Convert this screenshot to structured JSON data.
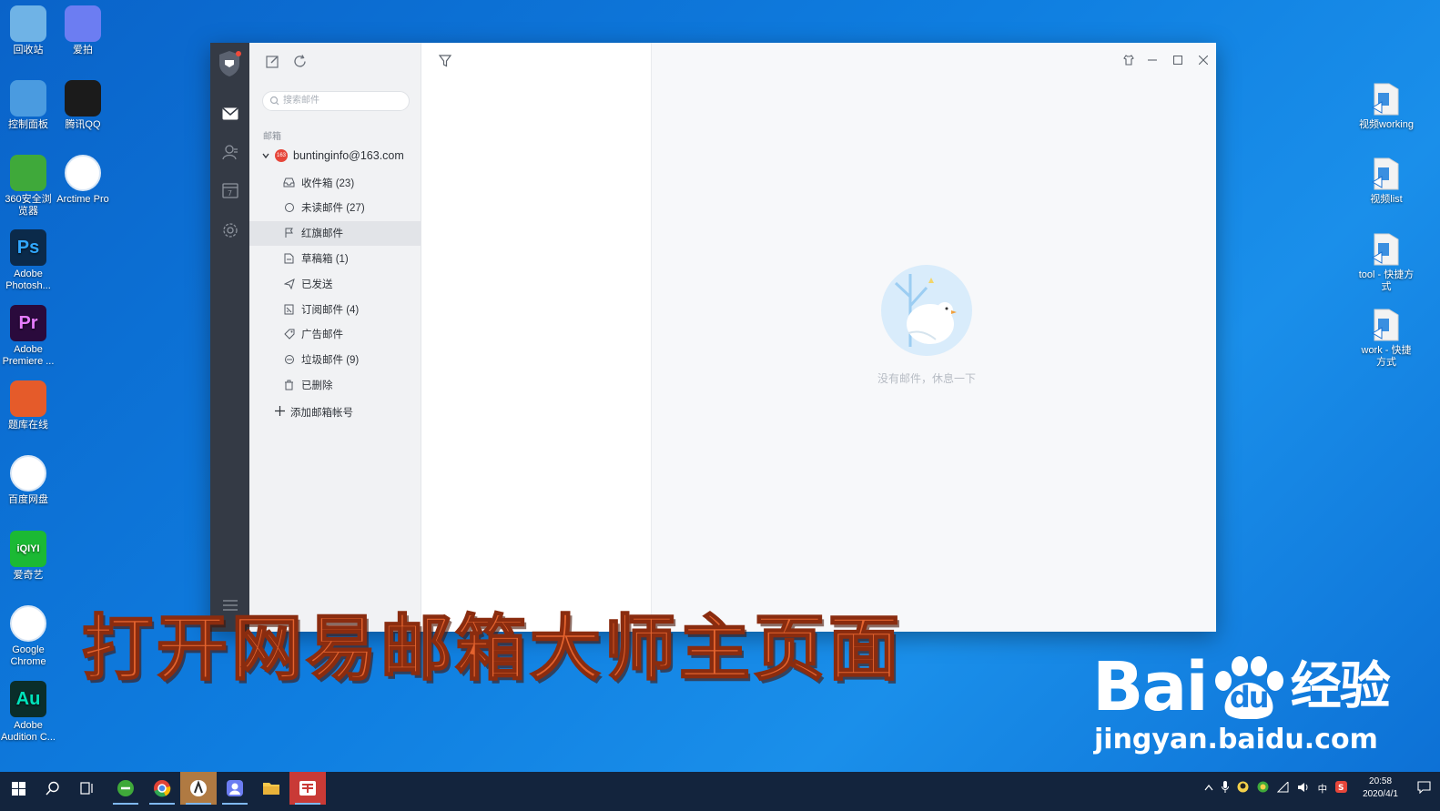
{
  "desktop": {
    "left_icons": [
      {
        "label": "回收站",
        "icon": "recycle-bin-icon",
        "color": "#6fb3e6"
      },
      {
        "label": "爱拍",
        "icon": "aipai-icon",
        "color": "#6c7df2"
      },
      {
        "label": "控制面板",
        "icon": "control-panel-icon",
        "color": "#4a9be0"
      },
      {
        "label": "腾讯QQ",
        "icon": "qq-penguin-icon",
        "color": "#1b1b1b"
      },
      {
        "label": "360安全浏览器",
        "icon": "360-browser-icon",
        "color": "#3fa93a"
      },
      {
        "label": "Arctime Pro",
        "icon": "arctime-icon",
        "color": "#ffffff"
      },
      {
        "label": "Adobe Photosh...",
        "icon": "photoshop-icon",
        "color": "#0b2a4a",
        "glyph": "Ps"
      },
      {
        "label": "Adobe Premiere ...",
        "icon": "premiere-icon",
        "color": "#2a0a3c",
        "glyph": "Pr"
      },
      {
        "label": "题库在线",
        "icon": "tiku-icon",
        "color": "#e55b2a"
      },
      {
        "label": "百度网盘",
        "icon": "baidu-netdisk-icon",
        "color": "#ffffff"
      },
      {
        "label": "爱奇艺",
        "icon": "iqiyi-icon",
        "color": "#1bb934",
        "glyph": "iQIYI"
      },
      {
        "label": "Google Chrome",
        "icon": "chrome-icon",
        "color": "#ffffff"
      },
      {
        "label": "Adobe Audition C...",
        "icon": "audition-icon",
        "color": "#0a2e2a",
        "glyph": "Au"
      }
    ],
    "right_icons": [
      {
        "label": "视频working",
        "icon": "folder-icon"
      },
      {
        "label": "视频list",
        "icon": "folder-icon"
      },
      {
        "label": "tool - 快捷方式",
        "icon": "folder-icon"
      },
      {
        "label": "work - 快捷方式",
        "icon": "folder-icon"
      }
    ]
  },
  "app": {
    "search_placeholder": "搜索邮件",
    "section_label": "邮箱",
    "account": "buntinginfo@163.com",
    "account_badge": "163",
    "folders": [
      {
        "label": "收件箱 (23)",
        "icon": "inbox-icon"
      },
      {
        "label": "未读邮件 (27)",
        "icon": "unread-circle-icon"
      },
      {
        "label": "红旗邮件",
        "icon": "flag-icon",
        "active": true
      },
      {
        "label": "草稿箱 (1)",
        "icon": "draft-icon"
      },
      {
        "label": "已发送",
        "icon": "send-icon"
      },
      {
        "label": "订阅邮件 (4)",
        "icon": "subscription-icon"
      },
      {
        "label": "广告邮件",
        "icon": "tag-icon"
      },
      {
        "label": "垃圾邮件 (9)",
        "icon": "spam-icon"
      },
      {
        "label": "已删除",
        "icon": "trash-icon"
      }
    ],
    "add_account": "添加邮箱帐号",
    "empty_text": "没有邮件，休息一下"
  },
  "overlay": {
    "caption": "打开网易邮箱大师主页面",
    "watermark_main": "Bai",
    "watermark_du": "du",
    "watermark_cn": "经验",
    "watermark_url": "jingyan.baidu.com"
  },
  "taskbar": {
    "time": "20:58",
    "date": "2020/4/1",
    "ime": "中"
  }
}
